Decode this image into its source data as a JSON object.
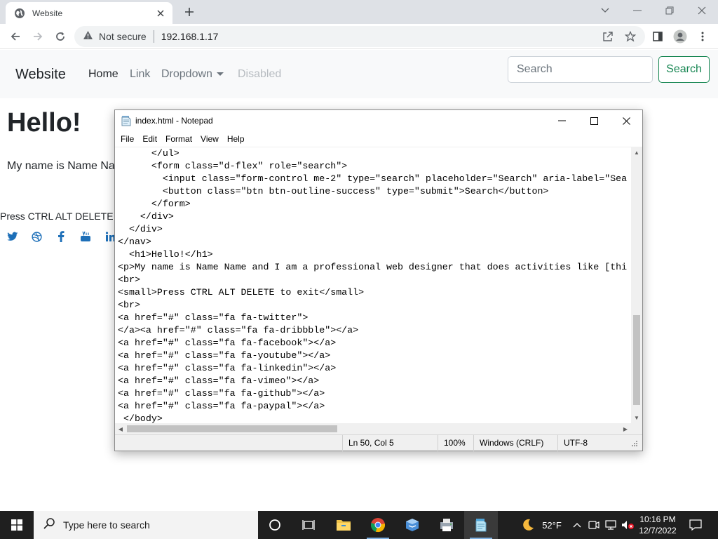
{
  "browser": {
    "tab_title": "Website",
    "security_label": "Not secure",
    "url": "192.168.1.17"
  },
  "page": {
    "brand": "Website",
    "nav": {
      "home": "Home",
      "link": "Link",
      "dropdown": "Dropdown",
      "disabled": "Disabled"
    },
    "search_placeholder": "Search",
    "search_button": "Search",
    "heading": "Hello!",
    "intro": "My name is Name Na",
    "small": "Press CTRL ALT DELETE to",
    "social_icons": [
      "twitter-icon",
      "dribbble-icon",
      "facebook-icon",
      "youtube-icon",
      "linkedin-icon"
    ]
  },
  "notepad": {
    "title": "index.html - Notepad",
    "menu": [
      "File",
      "Edit",
      "Format",
      "View",
      "Help"
    ],
    "lines": [
      "      </ul>",
      "      <form class=\"d-flex\" role=\"search\">",
      "        <input class=\"form-control me-2\" type=\"search\" placeholder=\"Search\" aria-label=\"Sea",
      "        <button class=\"btn btn-outline-success\" type=\"submit\">Search</button>",
      "      </form>",
      "    </div>",
      "  </div>",
      "</nav>",
      "  <h1>Hello!</h1>",
      "<p>My name is Name Name and I am a professional web designer that does activities like [thi",
      "<br>",
      "<small>Press CTRL ALT DELETE to exit</small>",
      "<br>",
      "<a href=\"#\" class=\"fa fa-twitter\">",
      "</a><a href=\"#\" class=\"fa fa-dribbble\"></a>",
      "<a href=\"#\" class=\"fa fa-facebook\"></a>",
      "<a href=\"#\" class=\"fa fa-youtube\"></a>",
      "<a href=\"#\" class=\"fa fa-linkedin\"></a>",
      "<a href=\"#\" class=\"fa fa-vimeo\"></a>",
      "<a href=\"#\" class=\"fa fa-github\"></a>",
      "<a href=\"#\" class=\"fa fa-paypal\"></a>",
      " </body>"
    ],
    "status": {
      "position": "Ln 50, Col 5",
      "zoom": "100%",
      "line_ending": "Windows (CRLF)",
      "encoding": "UTF-8"
    }
  },
  "taskbar": {
    "search_placeholder": "Type here to search",
    "weather": "52°F",
    "time": "10:16 PM",
    "date": "12/7/2022"
  },
  "colors": {
    "success": "#198754",
    "navbar_bg": "#f8f9fa",
    "taskbar_bg": "#1f1f1f"
  }
}
